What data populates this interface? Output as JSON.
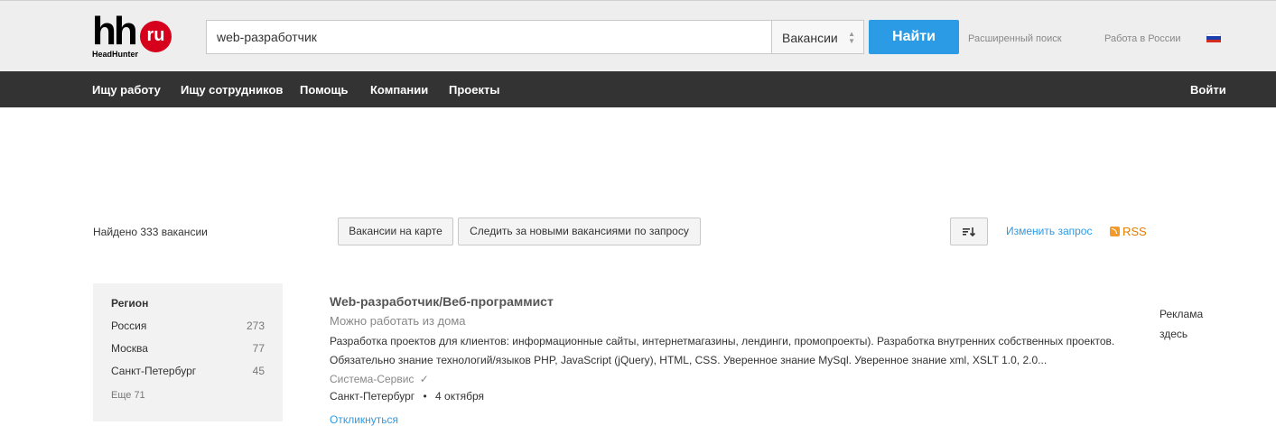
{
  "header": {
    "logo_text": "hh",
    "logo_badge": "ru",
    "logo_sub": "HeadHunter",
    "search_value": "web-разработчик",
    "type_select": "Вакансии",
    "find_label": "Найти",
    "advanced_search": "Расширенный поиск",
    "region_link": "Работа в России",
    "flag_icon": "russia-flag-icon"
  },
  "nav": {
    "items": [
      "Ищу работу",
      "Ищу сотрудников",
      "Помощь",
      "Компании",
      "Проекты"
    ],
    "login": "Войти"
  },
  "results": {
    "found_text": "Найдено 333 вакансии",
    "map_button": "Вакансии на карте",
    "subscribe_button": "Следить за новыми вакансиями по запросу",
    "sort_icon": "sort-icon",
    "change_query": "Изменить запрос",
    "rss": "RSS"
  },
  "sidebar": {
    "title": "Регион",
    "items": [
      {
        "label": "Россия",
        "count": "273"
      },
      {
        "label": "Москва",
        "count": "77"
      },
      {
        "label": "Санкт-Петербург",
        "count": "45"
      }
    ],
    "more": "Еще 71"
  },
  "vacancy": {
    "title": "Web-разработчик/Веб-программист",
    "remote": "Можно работать из дома",
    "desc_line1": "Разработка проектов для клиентов: информационные сайты, интернетмагазины, лендинги, промопроекты). Разработка внутренних собственных проектов.",
    "desc_line2": "Обязательно знание технологий/языков PHP, JavaScript (jQuery), HTML, CSS. Уверенное знание MySql. Уверенное знание xml, XSLT 1.0, 2.0...",
    "company": "Система-Сервис",
    "city": "Санкт-Петербург",
    "separator": "•",
    "date": "4 октября",
    "respond": "Откликнуться"
  },
  "ad": {
    "line1": "Реклама",
    "line2": "здесь"
  },
  "colors": {
    "accent": "#2b9be5",
    "nav_bg": "#333333",
    "logo_red": "#d6001c"
  }
}
